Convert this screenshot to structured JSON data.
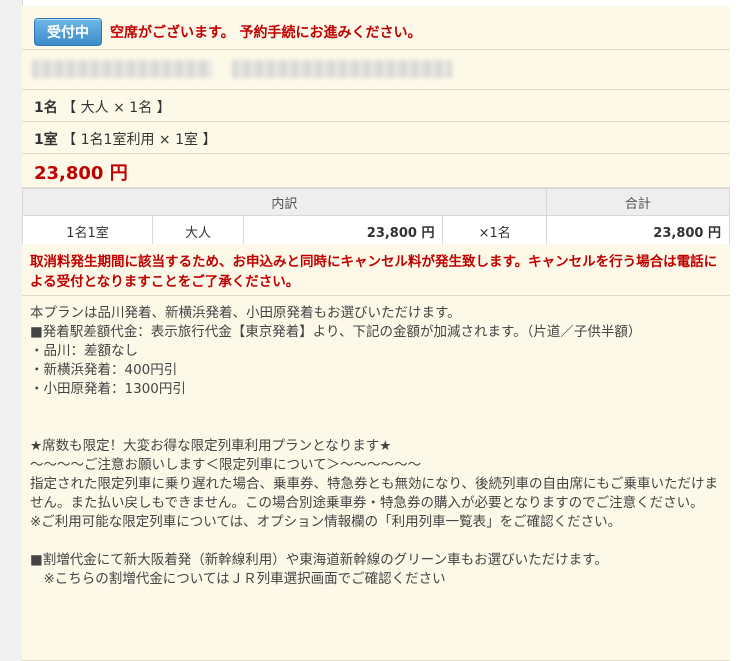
{
  "status": {
    "badge": "受付中",
    "message": "空席がございます。 予約手続にお進みください。"
  },
  "people": {
    "count": "1名",
    "detail": "【 大人 × 1名 】"
  },
  "room": {
    "count": "1室",
    "detail": "【 1名1室利用 × 1室 】"
  },
  "price_total": "23,800 円",
  "breakdown": {
    "header_detail": "内訳",
    "header_total": "合計",
    "row": {
      "room_type": "1名1室",
      "age": "大人",
      "unit_price": "23,800 円",
      "qty": "×1名",
      "total": "23,800 円"
    }
  },
  "cancel_note": "取消料発生期間に該当するため、お申込みと同時にキャンセル料が発生致します。キャンセルを行う場合は電話による受付となりますことをご了承ください。",
  "description": "本プランは品川発着、新横浜発着、小田原発着もお選びいただけます。\n■発着駅差額代金：表示旅行代金【東京発着】より、下記の金額が加減されます。（片道／子供半額）\n・品川：差額なし\n・新横浜発着：400円引\n・小田原発着：1300円引\n\n\n★席数も限定！大変お得な限定列車利用プランとなります★\n～～～～ご注意お願いします＜限定列車について＞～～～～～～\n指定された限定列車に乗り遅れた場合、乗車券、特急券とも無効になり、後続列車の自由席にもご乗車いただけません。また払い戻しもできません。この場合別途乗車券・特急券の購入が必要となりますのでご注意ください。\n※ご利用可能な限定列車については、オプション情報欄の「利用列車一覧表」をご確認ください。\n\n■割増代金にて新大阪着発（新幹線利用）や東海道新幹線のグリーン車もお選びいただけます。\n　※こちらの割増代金についてはＪＲ列車選択画面でご確認ください"
}
